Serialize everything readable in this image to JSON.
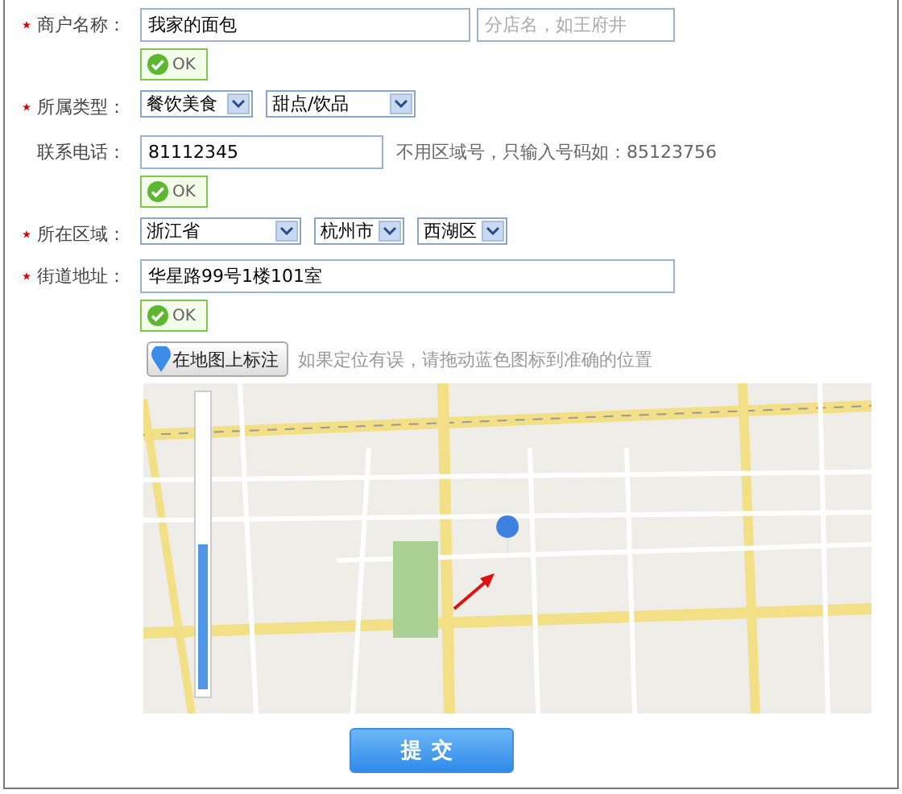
{
  "rows": [
    {
      "label": "商户名称：",
      "required": true,
      "controls": [
        {
          "kind": "field",
          "value": "我家的面包"
        },
        {
          "kind": "field",
          "placeholder": "分店名，如王府井"
        }
      ],
      "status": "OK"
    },
    {
      "label": "所属类型：",
      "required": true,
      "controls": [
        {
          "kind": "select",
          "value": "餐饮美食"
        },
        {
          "kind": "select",
          "value": "甜点/饮品"
        }
      ]
    },
    {
      "label": "联系电话：",
      "required": false,
      "controls": [
        {
          "kind": "field",
          "value": "81112345"
        }
      ],
      "hint": "不用区域号，只输入号码如：85123756",
      "status": "OK"
    },
    {
      "label": "所在区域：",
      "required": true,
      "controls": [
        {
          "kind": "select",
          "value": "浙江省"
        },
        {
          "kind": "select",
          "value": "杭州市"
        },
        {
          "kind": "select",
          "value": "西湖区"
        }
      ]
    },
    {
      "label": "街道地址：",
      "required": true,
      "controls": [
        {
          "kind": "field",
          "value": "华星路99号1楼101室"
        }
      ],
      "status": "OK"
    }
  ],
  "map_button": {
    "label": "在地图上标注"
  },
  "map_hint": "如果定位有误，请拖动蓝色图标到准确的位置",
  "submit": "提交"
}
